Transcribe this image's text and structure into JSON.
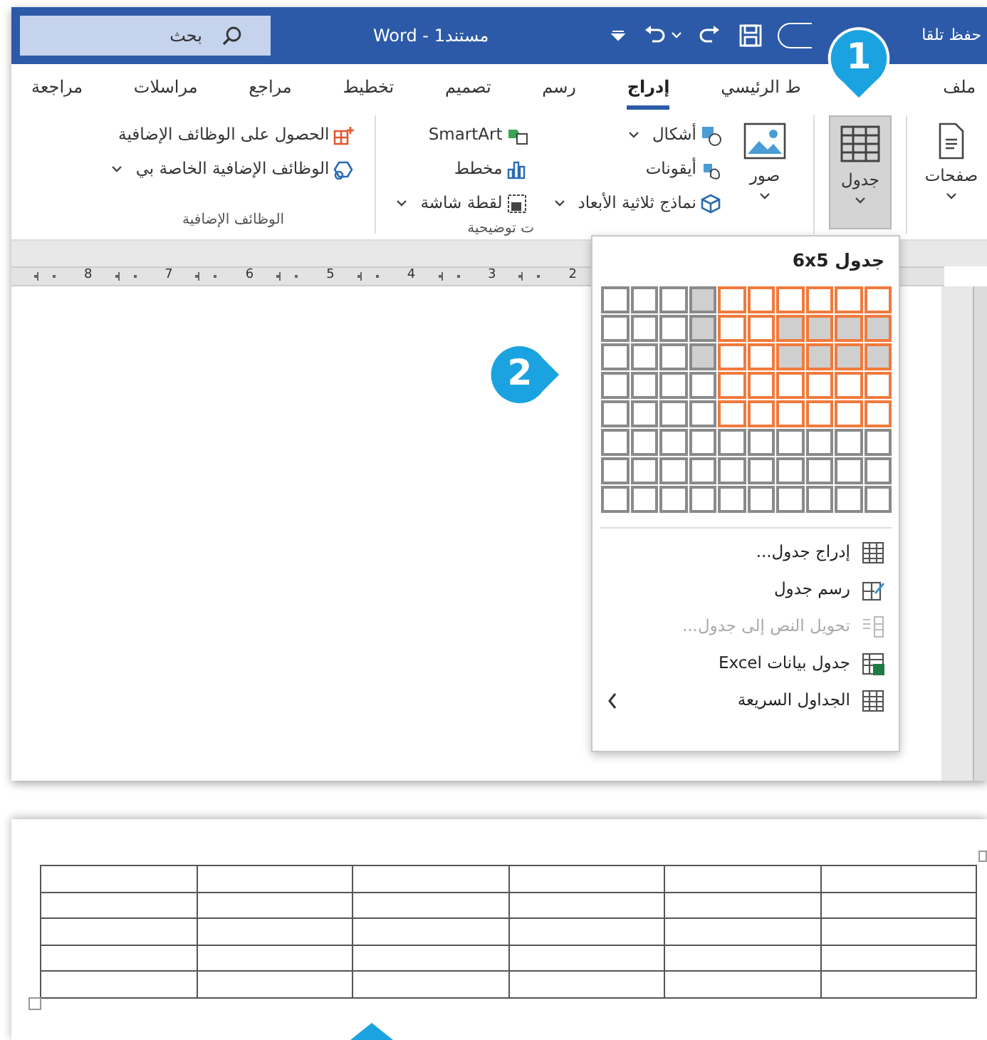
{
  "title_bar": {
    "autosave": "حفظ تلقا",
    "autosave_on": false,
    "title": "مستند1 - Word",
    "search": {
      "placeholder": "بحث"
    }
  },
  "tabs": [
    {
      "label": "ملف",
      "selected": false
    },
    {
      "label": "ط الرئيسي",
      "selected": false
    },
    {
      "label": "إدراج",
      "selected": true
    },
    {
      "label": "رسم",
      "selected": false
    },
    {
      "label": "تصميم",
      "selected": false
    },
    {
      "label": "تخطيط",
      "selected": false
    },
    {
      "label": "مراجع",
      "selected": false
    },
    {
      "label": "مراسلات",
      "selected": false
    },
    {
      "label": "مراجعة",
      "selected": false
    }
  ],
  "ribbon": {
    "pages": {
      "label": "صفحات"
    },
    "table": {
      "label": "جدول",
      "selected": true
    },
    "pictures": {
      "label": "صور"
    },
    "illustrations_col1": [
      {
        "kind": "shapes",
        "label": "أشكال",
        "dropdown": true
      },
      {
        "kind": "icons",
        "label": "أيقونات",
        "dropdown": false
      },
      {
        "kind": "models",
        "label": "نماذج ثلاثية الأبعاد",
        "dropdown": true
      }
    ],
    "illustrations_col2": [
      {
        "kind": "smartart",
        "label": "SmartArt",
        "dropdown": false
      },
      {
        "kind": "chart",
        "label": "مخطط",
        "dropdown": false
      },
      {
        "kind": "screenshot",
        "label": "لقطة شاشة",
        "dropdown": true
      }
    ],
    "illustrations_group": "ت توضيحية",
    "addins": [
      {
        "kind": "get",
        "label": "الحصول على الوظائف الإضافية",
        "dropdown": false
      },
      {
        "kind": "my",
        "label": "الوظائف الإضافية الخاصة بي",
        "dropdown": true
      }
    ],
    "addins_group": "الوظائف الإضافية"
  },
  "ruler": [
    "2",
    "3",
    "4",
    "5",
    "6",
    "7",
    "8"
  ],
  "table_menu": {
    "header": "جدول 6x5",
    "grid": [
      {
        "cells": [
          {
            "selected": true,
            "shaded": false
          },
          {
            "selected": true,
            "shaded": false
          },
          {
            "selected": true,
            "shaded": false
          },
          {
            "selected": true,
            "shaded": false
          },
          {
            "selected": true,
            "shaded": false
          },
          {
            "selected": true,
            "shaded": false
          },
          {
            "selected": false,
            "shaded": true
          },
          {
            "selected": false,
            "shaded": false
          },
          {
            "selected": false,
            "shaded": false
          },
          {
            "selected": false,
            "shaded": false
          }
        ]
      },
      {
        "cells": [
          {
            "selected": true,
            "shaded": true
          },
          {
            "selected": true,
            "shaded": true
          },
          {
            "selected": true,
            "shaded": true
          },
          {
            "selected": true,
            "shaded": true
          },
          {
            "selected": true,
            "shaded": false
          },
          {
            "selected": true,
            "shaded": false
          },
          {
            "selected": false,
            "shaded": true
          },
          {
            "selected": false,
            "shaded": false
          },
          {
            "selected": false,
            "shaded": false
          },
          {
            "selected": false,
            "shaded": false
          }
        ]
      },
      {
        "cells": [
          {
            "selected": true,
            "shaded": true
          },
          {
            "selected": true,
            "shaded": true
          },
          {
            "selected": true,
            "shaded": true
          },
          {
            "selected": true,
            "shaded": true
          },
          {
            "selected": true,
            "shaded": false
          },
          {
            "selected": true,
            "shaded": false
          },
          {
            "selected": false,
            "shaded": true
          },
          {
            "selected": false,
            "shaded": false
          },
          {
            "selected": false,
            "shaded": false
          },
          {
            "selected": false,
            "shaded": false
          }
        ]
      },
      {
        "cells": [
          {
            "selected": true,
            "shaded": false
          },
          {
            "selected": true,
            "shaded": false
          },
          {
            "selected": true,
            "shaded": false
          },
          {
            "selected": true,
            "shaded": false
          },
          {
            "selected": true,
            "shaded": false
          },
          {
            "selected": true,
            "shaded": false
          },
          {
            "selected": false,
            "shaded": false
          },
          {
            "selected": false,
            "shaded": false
          },
          {
            "selected": false,
            "shaded": false
          },
          {
            "selected": false,
            "shaded": false
          }
        ]
      },
      {
        "cells": [
          {
            "selected": true,
            "shaded": false
          },
          {
            "selected": true,
            "shaded": false
          },
          {
            "selected": true,
            "shaded": false
          },
          {
            "selected": true,
            "shaded": false
          },
          {
            "selected": true,
            "shaded": false
          },
          {
            "selected": true,
            "shaded": false
          },
          {
            "selected": false,
            "shaded": false
          },
          {
            "selected": false,
            "shaded": false
          },
          {
            "selected": false,
            "shaded": false
          },
          {
            "selected": false,
            "shaded": false
          }
        ]
      },
      {
        "cells": [
          {
            "selected": false,
            "shaded": false
          },
          {
            "selected": false,
            "shaded": false
          },
          {
            "selected": false,
            "shaded": false
          },
          {
            "selected": false,
            "shaded": false
          },
          {
            "selected": false,
            "shaded": false
          },
          {
            "selected": false,
            "shaded": false
          },
          {
            "selected": false,
            "shaded": false
          },
          {
            "selected": false,
            "shaded": false
          },
          {
            "selected": false,
            "shaded": false
          },
          {
            "selected": false,
            "shaded": false
          }
        ]
      },
      {
        "cells": [
          {
            "selected": false,
            "shaded": false
          },
          {
            "selected": false,
            "shaded": false
          },
          {
            "selected": false,
            "shaded": false
          },
          {
            "selected": false,
            "shaded": false
          },
          {
            "selected": false,
            "shaded": false
          },
          {
            "selected": false,
            "shaded": false
          },
          {
            "selected": false,
            "shaded": false
          },
          {
            "selected": false,
            "shaded": false
          },
          {
            "selected": false,
            "shaded": false
          },
          {
            "selected": false,
            "shaded": false
          }
        ]
      },
      {
        "cells": [
          {
            "selected": false,
            "shaded": false
          },
          {
            "selected": false,
            "shaded": false
          },
          {
            "selected": false,
            "shaded": false
          },
          {
            "selected": false,
            "shaded": false
          },
          {
            "selected": false,
            "shaded": false
          },
          {
            "selected": false,
            "shaded": false
          },
          {
            "selected": false,
            "shaded": false
          },
          {
            "selected": false,
            "shaded": false
          },
          {
            "selected": false,
            "shaded": false
          },
          {
            "selected": false,
            "shaded": false
          }
        ]
      }
    ],
    "items": [
      {
        "kind": "insert",
        "label": "إدراج جدول...",
        "disabled": false,
        "submenu": false
      },
      {
        "kind": "draw",
        "label": "رسم جدول",
        "disabled": false,
        "submenu": false
      },
      {
        "kind": "convert",
        "label": "تحويل النص إلى جدول...",
        "disabled": true,
        "submenu": false
      },
      {
        "kind": "excel",
        "label": "جدول بيانات Excel",
        "disabled": false,
        "submenu": false
      },
      {
        "kind": "quick",
        "label": "الجداول السريعة",
        "disabled": false,
        "submenu": true
      }
    ]
  },
  "callouts": [
    {
      "kind": "down",
      "label": "1"
    },
    {
      "kind": "right",
      "label": "2"
    },
    {
      "kind": "up"
    }
  ],
  "result_table": {
    "rows": [
      {
        "cells": [
          {
            "kind": "empty"
          },
          {
            "kind": "empty"
          },
          {
            "kind": "empty"
          },
          {
            "kind": "empty"
          },
          {
            "kind": "empty"
          },
          {
            "kind": "empty"
          }
        ]
      },
      {
        "cells": [
          {
            "kind": "empty"
          },
          {
            "kind": "empty"
          },
          {
            "kind": "empty"
          },
          {
            "kind": "empty"
          },
          {
            "kind": "empty"
          },
          {
            "kind": "empty"
          }
        ]
      },
      {
        "cells": [
          {
            "kind": "empty"
          },
          {
            "kind": "empty"
          },
          {
            "kind": "empty"
          },
          {
            "kind": "empty"
          },
          {
            "kind": "empty"
          },
          {
            "kind": "empty"
          }
        ]
      },
      {
        "cells": [
          {
            "kind": "empty"
          },
          {
            "kind": "empty"
          },
          {
            "kind": "empty"
          },
          {
            "kind": "empty"
          },
          {
            "kind": "empty"
          },
          {
            "kind": "empty"
          }
        ]
      },
      {
        "cells": [
          {
            "kind": "empty"
          },
          {
            "kind": "empty"
          },
          {
            "kind": "empty"
          },
          {
            "kind": "empty"
          },
          {
            "kind": "empty"
          },
          {
            "kind": "empty"
          }
        ]
      }
    ]
  }
}
